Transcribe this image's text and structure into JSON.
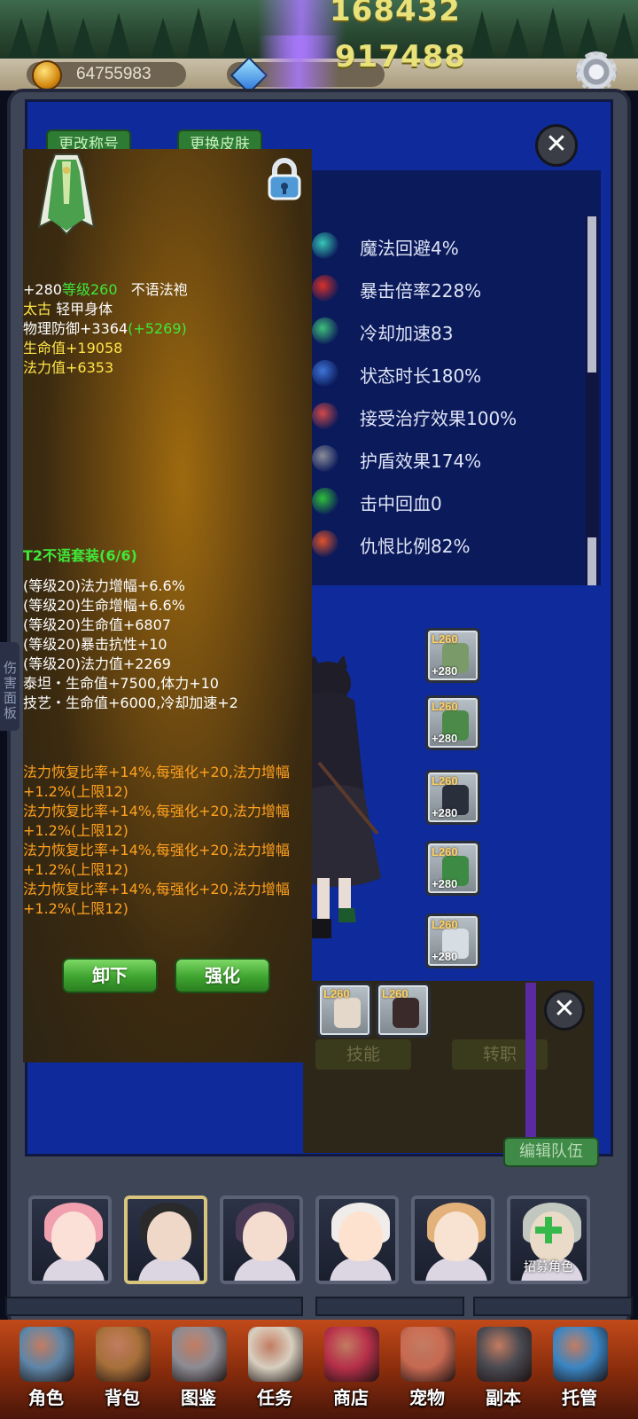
{
  "top": {
    "score1": "168432",
    "score2": "917488"
  },
  "resources": {
    "gold": "64755983",
    "gold_icon": "gold-coin-icon",
    "gem_icon": "blue-gem-icon",
    "settings_icon": "gear-icon"
  },
  "profile_buttons": {
    "rename": "更改称号",
    "change_skin": "更换皮肤"
  },
  "stats": [
    {
      "icon": "magic-dodge-icon",
      "text": "魔法回避4%",
      "color": "#37c6b5"
    },
    {
      "icon": "crit-multiplier-icon",
      "text": "暴击倍率228%",
      "color": "#d8302a"
    },
    {
      "icon": "cooldown-icon",
      "text": "冷却加速83",
      "color": "#3fbf7a"
    },
    {
      "icon": "status-duration-icon",
      "text": "状态时长180%",
      "color": "#3f74d8"
    },
    {
      "icon": "healing-received-icon",
      "text": "接受治疗效果100%",
      "color": "#d04a4a"
    },
    {
      "icon": "shield-effect-icon",
      "text": "护盾效果174%",
      "color": "#8a8e98"
    },
    {
      "icon": "hit-heal-icon",
      "text": "击中回血0",
      "color": "#2fbf3a"
    },
    {
      "icon": "threat-icon",
      "text": "仇恨比例82%",
      "color": "#e0532a"
    }
  ],
  "equipment": {
    "right_slots": [
      {
        "level": "L260",
        "plus": "+280",
        "color": "#7a9a6a"
      },
      {
        "level": "L260",
        "plus": "+280",
        "color": "#4c8a4a"
      },
      {
        "level": "L260",
        "plus": "+280",
        "color": "#2a2f3c"
      },
      {
        "level": "L260",
        "plus": "+280",
        "color": "#3d8a44"
      },
      {
        "level": "L260",
        "plus": "+280",
        "color": "#d6dde3"
      }
    ],
    "bottom_slots": [
      {
        "level": "L260",
        "plus": "",
        "color": "#e3d8c9"
      },
      {
        "level": "L260",
        "plus": "",
        "color": "#3a2a2a"
      }
    ]
  },
  "lower_panel": {
    "skills": "技能",
    "job_change": "转职",
    "edit_team": "编辑队伍"
  },
  "damage_tab": "伤害面板",
  "tooltip": {
    "item_icon": "green-robe-icon",
    "lock_icon": "padlock-icon",
    "enhance": "+280",
    "level": "等级260",
    "name": "不语法袍",
    "rarity": "太古",
    "type": "轻甲身体",
    "def_label": "物理防御+3364",
    "def_bonus": "(+5269)",
    "hp": "生命值+19058",
    "mp": "法力值+6353",
    "set_title": "T2不语套装(6/6)",
    "set_lines": [
      "(等级20)法力增幅+6.6%",
      "(等级20)生命增幅+6.6%",
      "(等级20)生命值+6807",
      "(等级20)暴击抗性+10",
      "(等级20)法力值+2269",
      "泰坦・生命值+7500,体力+10",
      "技艺・生命值+6000,冷却加速+2"
    ],
    "affixes": [
      "法力恢复比率+14%,每强化+20,法力增幅+1.2%(上限12)",
      "法力恢复比率+14%,每强化+20,法力增幅+1.2%(上限12)",
      "法力恢复比率+14%,每强化+20,法力增幅+1.2%(上限12)",
      "法力恢复比率+14%,每强化+20,法力增幅+1.2%(上限12)"
    ],
    "unequip": "卸下",
    "strengthen": "强化"
  },
  "portraits": [
    {
      "hair": "#f0a0ae",
      "skin": "#fbe0d8"
    },
    {
      "hair": "#2a2a2a",
      "skin": "#f0d8c8"
    },
    {
      "hair": "#4a3a55",
      "skin": "#f4dccf"
    },
    {
      "hair": "#f0ecea",
      "skin": "#fde3cf"
    },
    {
      "hair": "#e2b27a",
      "skin": "#f8e2d2"
    },
    {
      "hair": "#c2c8c0",
      "skin": "#eadbc8"
    }
  ],
  "recruit": "招募角色",
  "nav": [
    {
      "label": "角色",
      "icon": "helmet-icon",
      "color": "#5e86a8"
    },
    {
      "label": "背包",
      "icon": "backpack-icon",
      "color": "#a8703a"
    },
    {
      "label": "图鉴",
      "icon": "book-icon",
      "color": "#8c8c94"
    },
    {
      "label": "任务",
      "icon": "scroll-icon",
      "color": "#d8cfc0"
    },
    {
      "label": "商店",
      "icon": "shop-icon",
      "color": "#b7304a"
    },
    {
      "label": "宠物",
      "icon": "meat-icon",
      "color": "#c86a52"
    },
    {
      "label": "副本",
      "icon": "skull-icon",
      "color": "#4a4a52"
    },
    {
      "label": "托管",
      "icon": "calendar-icon",
      "color": "#3a86c4"
    }
  ]
}
